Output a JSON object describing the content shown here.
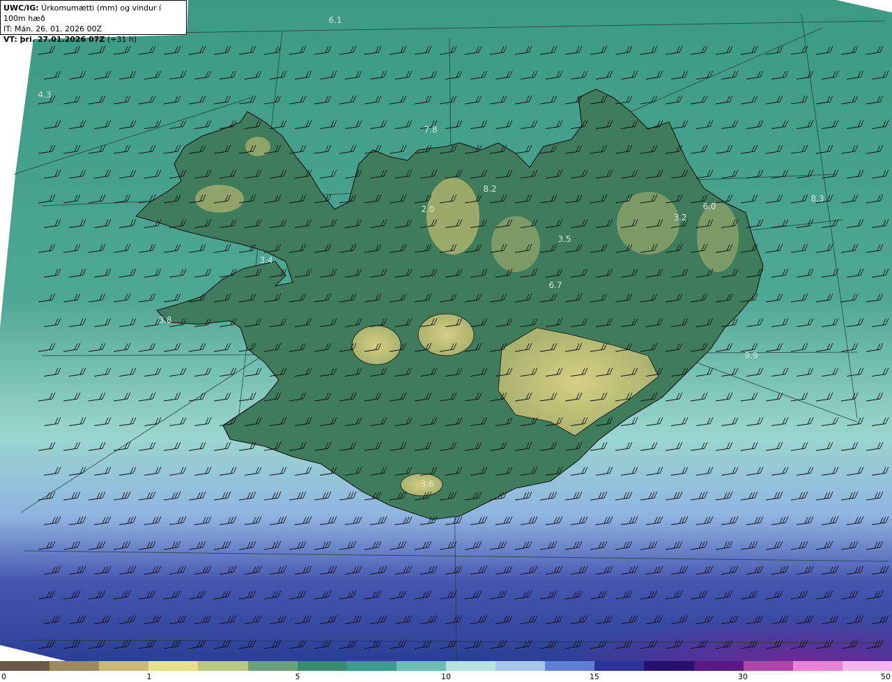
{
  "header": {
    "line1_bold": "UWC/IG:",
    "line1": " Úrkomumætti (mm) og vindur í 100m hæð",
    "line2": "IT: Mán. 26. 01. 2026 00Z",
    "line3_bold": "VT: þri. 27.01.2026 07Z",
    "line3": " (+31 h)"
  },
  "map": {
    "point_labels": [
      "6.1",
      "4.3",
      "7.8",
      "8.2",
      "2.0",
      "3.5",
      "3.2",
      "8.3",
      "6.0",
      "3.4",
      "6.7",
      "3.8",
      "9.9",
      "3.6"
    ],
    "colors": {
      "ocean_north": "#3c9a84",
      "ocean_south": "#9ad6cf",
      "ocean_deep": "#2c3f96",
      "land": "#3e7c5c",
      "highland": "#c9c477",
      "coast": "#111111",
      "barb": "#111111"
    }
  },
  "colorbar": {
    "labels": [
      "0",
      "1",
      "5",
      "10",
      "15",
      "30",
      "50"
    ],
    "colors": [
      "#6b5a47",
      "#9f8a5e",
      "#cdb877",
      "#e8e08a",
      "#b7c77e",
      "#6aa07a",
      "#3c8a6c",
      "#3c9c8c",
      "#6dbdb5",
      "#b5e4e0",
      "#a7c7ea",
      "#5f7fd0",
      "#2b3599",
      "#28106e",
      "#5a1a86",
      "#b045a8",
      "#e884d8",
      "#f5b5ec"
    ]
  }
}
